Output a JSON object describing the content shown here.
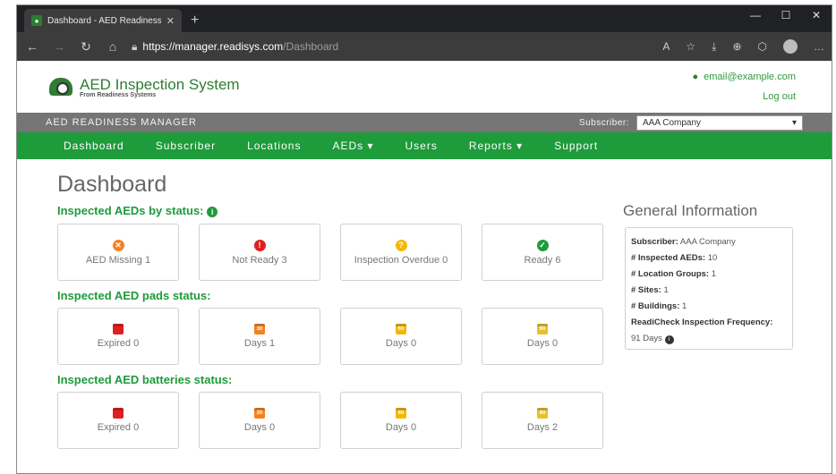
{
  "browser": {
    "tab_title": "Dashboard - AED Readiness Ma",
    "url_scheme_host": "https://manager.readisys.com",
    "url_path": "/Dashboard"
  },
  "header": {
    "app_name": "AED Inspection System",
    "tagline": "From Readiness Systems",
    "user_email": "email@example.com",
    "logout_label": "Log out"
  },
  "subbar": {
    "title": "AED READINESS MANAGER",
    "subscriber_label": "Subscriber:",
    "subscriber_value": "AAA Company"
  },
  "nav": {
    "items": [
      "Dashboard",
      "Subscriber",
      "Locations",
      "AEDs ▾",
      "Users",
      "Reports ▾",
      "Support"
    ]
  },
  "page_title": "Dashboard",
  "sections": {
    "status_title": "Inspected AEDs by status:",
    "pads_title": "Inspected AED pads status:",
    "batteries_title": "Inspected AED batteries status:"
  },
  "status_cards": [
    {
      "label": "AED Missing 1",
      "icon": "x-circle-icon",
      "color": "#f5821f",
      "glyph": "✕"
    },
    {
      "label": "Not Ready 3",
      "icon": "exclamation-circle-icon",
      "color": "#e02020",
      "glyph": "!"
    },
    {
      "label": "Inspection Overdue 0",
      "icon": "question-circle-icon",
      "color": "#f5b800",
      "glyph": "?"
    },
    {
      "label": "Ready 6",
      "icon": "check-circle-icon",
      "color": "#1e9b3a",
      "glyph": "✓"
    }
  ],
  "pads_cards": [
    {
      "label": "Expired 0",
      "icon": "calendar-icon",
      "color": "#e02020",
      "glyph": ""
    },
    {
      "label": "Days 1",
      "icon": "calendar-30-icon",
      "color": "#f5821f",
      "glyph": "30"
    },
    {
      "label": "Days 0",
      "icon": "calendar-60-icon",
      "color": "#f5b800",
      "glyph": "60"
    },
    {
      "label": "Days 0",
      "icon": "calendar-90-icon",
      "color": "#e6c229",
      "glyph": "90"
    }
  ],
  "battery_cards": [
    {
      "label": "Expired 0",
      "icon": "calendar-icon",
      "color": "#e02020",
      "glyph": ""
    },
    {
      "label": "Days 0",
      "icon": "calendar-30-icon",
      "color": "#f5821f",
      "glyph": "30"
    },
    {
      "label": "Days 0",
      "icon": "calendar-60-icon",
      "color": "#f5b800",
      "glyph": "60"
    },
    {
      "label": "Days 2",
      "icon": "calendar-90-icon",
      "color": "#e6c229",
      "glyph": "90"
    }
  ],
  "general_info": {
    "title": "General Information",
    "subscriber_k": "Subscriber:",
    "subscriber_v": "AAA Company",
    "inspected_k": "# Inspected AEDs:",
    "inspected_v": "10",
    "locgroups_k": "# Location Groups:",
    "locgroups_v": "1",
    "sites_k": "# Sites:",
    "sites_v": "1",
    "buildings_k": "# Buildings:",
    "buildings_v": "1",
    "freq_k": "ReadiCheck Inspection Frequency:",
    "freq_v": "91 Days"
  }
}
